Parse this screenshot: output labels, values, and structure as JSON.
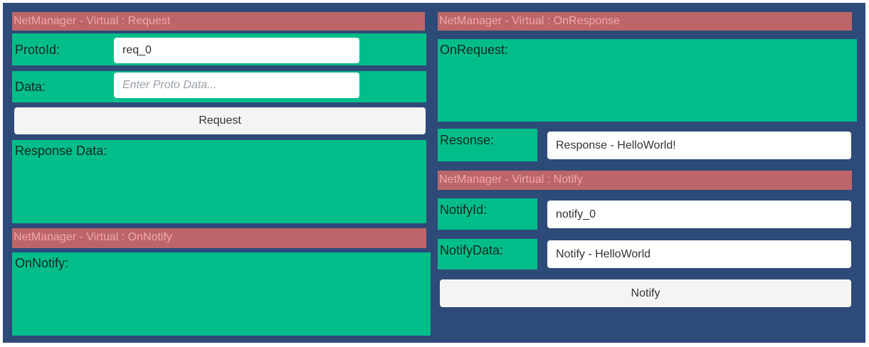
{
  "left": {
    "request_header": "NetManager - Virtual : Request",
    "protoid_label": "ProtoId:",
    "protoid_value": "req_0",
    "data_label": "Data:",
    "data_placeholder": "Enter Proto Data...",
    "request_button": "Request",
    "response_data_label": "Response Data:",
    "onnotify_header": "NetManager - Virtual : OnNotify",
    "onnotify_label": "OnNotify:"
  },
  "right": {
    "onresponse_header": "NetManager - Virtual : OnResponse",
    "onrequest_label": "OnRequest:",
    "response_label": "Resonse:",
    "response_value": "Response - HelloWorld!",
    "notify_header": "NetManager - Virtual :  Notify",
    "notifyid_label": "NotifyId:",
    "notifyid_value": "notify_0",
    "notifydata_label": "NotifyData:",
    "notifydata_value": "Notify - HelloWorld",
    "notify_button": "Notify"
  },
  "colors": {
    "background": "#2e4a79",
    "header": "#bd6669",
    "panel": "#00bd8a",
    "button": "#f4f4f4"
  }
}
